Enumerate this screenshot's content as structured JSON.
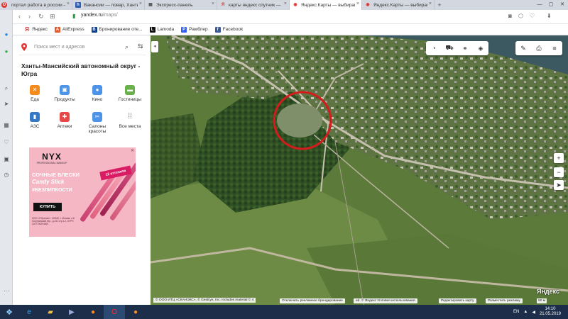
{
  "tabs": [
    {
      "label": "портал работа в россии —",
      "icon": "yandex-icon",
      "color": "#e0312d",
      "active": false
    },
    {
      "label": "Вакансии — повар, Ханты",
      "icon": "hh-icon",
      "color": "#2a5fb8",
      "active": false
    },
    {
      "label": "Экспресс-панель",
      "icon": "grid-icon",
      "color": "#555",
      "active": false
    },
    {
      "label": "карты яндекс спутник —",
      "icon": "yandex-icon",
      "color": "#e0312d",
      "active": false
    },
    {
      "label": "Яндекс.Карты — выбирай",
      "icon": "yandex-maps-icon",
      "color": "#e0312d",
      "active": true
    },
    {
      "label": "Яндекс.Карты — выбирай",
      "icon": "yandex-maps-icon",
      "color": "#e0312d",
      "active": false
    }
  ],
  "address": {
    "host": "yandex.ru",
    "path": "/maps/"
  },
  "bookmarks": [
    {
      "label": "Яндекс",
      "color": "#e0312d",
      "glyph": "Я"
    },
    {
      "label": "AliExpress",
      "color": "#e8572a",
      "glyph": "A"
    },
    {
      "label": "Бронирование оте...",
      "color": "#0b3a8c",
      "glyph": "B"
    },
    {
      "label": "Lamoda",
      "color": "#111111",
      "glyph": "L"
    },
    {
      "label": "Рамблер",
      "color": "#315efb",
      "glyph": "P"
    },
    {
      "label": "Facebook",
      "color": "#3b5998",
      "glyph": "f"
    }
  ],
  "panel": {
    "search_placeholder": "Поиск мест и адресов",
    "region": "Ханты-Мансийский автономный округ - Югра",
    "categories": [
      {
        "label": "Еда",
        "icon": "food-icon",
        "color": "#f48a1c",
        "glyph": "✕"
      },
      {
        "label": "Продукты",
        "icon": "grocery-icon",
        "color": "#4d94e8",
        "glyph": "▣"
      },
      {
        "label": "Кино",
        "icon": "cinema-icon",
        "color": "#4d94e8",
        "glyph": "●"
      },
      {
        "label": "Гостиницы",
        "icon": "hotel-icon",
        "color": "#6ab04c",
        "glyph": "▬"
      },
      {
        "label": "АЗС",
        "icon": "gas-station-icon",
        "color": "#3678c8",
        "glyph": "▮"
      },
      {
        "label": "Аптеки",
        "icon": "pharmacy-icon",
        "color": "#e64848",
        "glyph": "✚"
      },
      {
        "label": "Салоны красоты",
        "icon": "beauty-salon-icon",
        "color": "#4d94e8",
        "glyph": "✂"
      },
      {
        "label": "Все места",
        "icon": "all-places-icon",
        "color": "#666666",
        "glyph": "⋮⋮"
      }
    ]
  },
  "ad": {
    "brand": "NYX",
    "brand_sub": "PROFESSIONAL MAKEUP",
    "headline": "СОЧНЫЕ БЛЕСКИ",
    "product": "Candy Slick",
    "hashtag": "#БЕЗЛИПКОСТИ",
    "shades": "12 оттенков",
    "cta": "КУПИТЬ",
    "fine_print": "ООО «Л'Ореаль». 119180, г. Москва, 4-й Голутвинский пер., д.1/8, стр.1-2, ОГРН 1027700204000"
  },
  "map": {
    "copyright": "© ООО ИТЦ «СКАНЭКС», © GeoEye, Inc. Includes material © 4",
    "ad_branding": "Отключить рекламное брендирование",
    "terms": "ed. © Яндекс Условия использования",
    "edit_map": "Редактировать карту",
    "advertise": "Разместить рекламу",
    "scale": "50 м",
    "logo": "Яндекс"
  },
  "taskbar": {
    "lang": "EN",
    "time": "14:10",
    "date": "21.05.2019"
  }
}
